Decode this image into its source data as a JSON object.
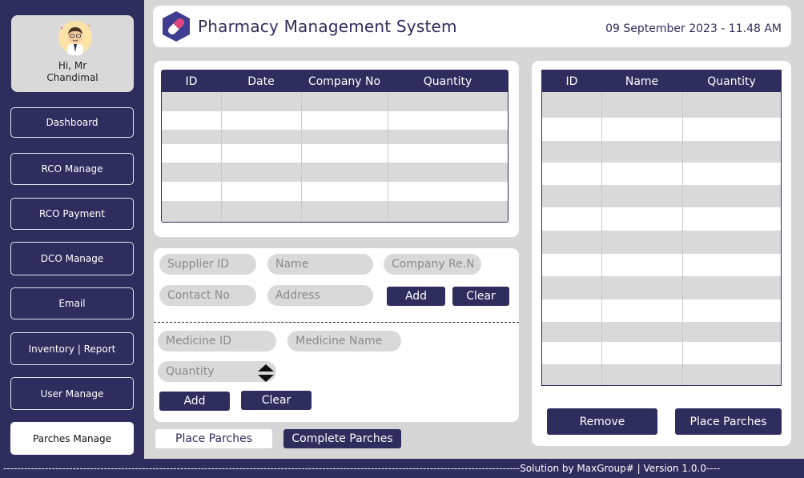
{
  "profile": {
    "greeting": "Hi, Mr",
    "name": "Chandimal"
  },
  "nav": [
    {
      "label": "Dashboard"
    },
    {
      "label": "RCO Manage"
    },
    {
      "label": "RCO Payment"
    },
    {
      "label": "DCO Manage"
    },
    {
      "label": "Email"
    },
    {
      "label": "Inventory | Report"
    },
    {
      "label": "User Manage"
    },
    {
      "label": "Parches Manage",
      "active": true
    }
  ],
  "header": {
    "title": "Pharmacy Management System",
    "datetime": "09 September 2023 - 11.48 AM"
  },
  "order_table": {
    "columns": [
      "ID",
      "Date",
      "Company No",
      "Quantity"
    ],
    "rows": 7
  },
  "item_table": {
    "columns": [
      "ID",
      "Name",
      "Quantity"
    ],
    "rows": 13
  },
  "supplier_form": {
    "supplier_id": "Supplier ID",
    "name": "Name",
    "company_reg": "Company Re.No",
    "contact": "Contact No",
    "address": "Address",
    "add": "Add",
    "clear": "Clear"
  },
  "medicine_form": {
    "medicine_id": "Medicine ID",
    "medicine_name": "Medicine Name",
    "quantity": "Quantity",
    "add": "Add",
    "clear": "Clear"
  },
  "actions": {
    "place_parches": "Place Parches",
    "complete_parches": "Complete Parches",
    "remove": "Remove",
    "place_parches_right": "Place Parches"
  },
  "footer": {
    "text": "Solution by MaxGroup# | Version 1.0.0"
  },
  "colors": {
    "primary": "#2f2c5e",
    "panel": "#d6d6d6",
    "row_alt": "#d9d9d9"
  }
}
